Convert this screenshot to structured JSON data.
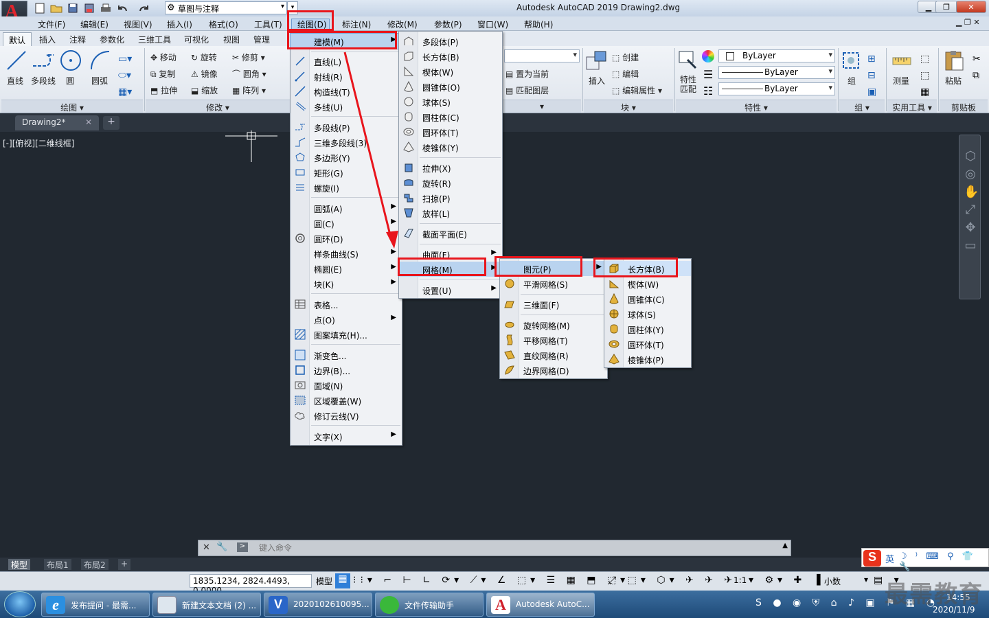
{
  "titlebar": {
    "workspace": "草图与注释",
    "window_title": "Autodesk AutoCAD 2019    Drawing2.dwg"
  },
  "menubar": {
    "items": [
      "文件(F)",
      "编辑(E)",
      "视图(V)",
      "插入(I)",
      "格式(O)",
      "工具(T)",
      "绘图(D)",
      "标注(N)",
      "修改(M)",
      "参数(P)",
      "窗口(W)",
      "帮助(H)"
    ]
  },
  "ribbon_tabs": [
    "默认",
    "插入",
    "注释",
    "参数化",
    "三维工具",
    "可视化",
    "视图",
    "管理"
  ],
  "ribbon": {
    "draw": [
      "直线",
      "多段线",
      "圆",
      "圆弧"
    ],
    "modify": [
      "移动",
      "旋转",
      "修剪",
      "复制",
      "镜像",
      "圆角",
      "拉伸",
      "缩放",
      "阵列"
    ],
    "layers": [
      "置为当前",
      "匹配图层"
    ],
    "block": [
      "插入",
      "创建",
      "编辑",
      "编辑属性"
    ],
    "properties": {
      "match": "特性匹配",
      "color": "ByLayer",
      "linetype": "ByLayer",
      "lineweight": "ByLayer"
    },
    "groups": [
      "组"
    ],
    "utilities": [
      "测量"
    ],
    "clipboard": [
      "粘贴"
    ],
    "panel_titles": [
      "绘图",
      "修改",
      "块",
      "特性",
      "组",
      "实用工具",
      "剪贴板"
    ]
  },
  "file_tab": "Drawing2*",
  "viewport_label": "[-][俯视][二维线框]",
  "draw_menu": {
    "items": [
      "建模(M)",
      "直线(L)",
      "射线(R)",
      "构造线(T)",
      "多线(U)",
      "多段线(P)",
      "三维多段线(3)",
      "多边形(Y)",
      "矩形(G)",
      "螺旋(I)",
      "圆弧(A)",
      "圆(C)",
      "圆环(D)",
      "样条曲线(S)",
      "椭圆(E)",
      "块(K)",
      "表格...",
      "点(O)",
      "图案填充(H)...",
      "渐变色...",
      "边界(B)...",
      "面域(N)",
      "区域覆盖(W)",
      "修订云线(V)",
      "文字(X)"
    ]
  },
  "modeling_menu": {
    "items": [
      "多段体(P)",
      "长方体(B)",
      "楔体(W)",
      "圆锥体(O)",
      "球体(S)",
      "圆柱体(C)",
      "圆环体(T)",
      "棱锥体(Y)",
      "拉伸(X)",
      "旋转(R)",
      "扫掠(P)",
      "放样(L)",
      "截面平面(E)",
      "曲面(F)",
      "网格(M)",
      "设置(U)"
    ]
  },
  "mesh_menu": {
    "items": [
      "图元(P)",
      "平滑网格(S)",
      "三维面(F)",
      "旋转网格(M)",
      "平移网格(T)",
      "直纹网格(R)",
      "边界网格(D)"
    ]
  },
  "primitive_menu": {
    "items": [
      "长方体(B)",
      "楔体(W)",
      "圆锥体(C)",
      "球体(S)",
      "圆柱体(Y)",
      "圆环体(T)",
      "棱锥体(P)"
    ]
  },
  "cmdline": {
    "placeholder": "键入命令"
  },
  "layout_tabs": [
    "模型",
    "布局1",
    "布局2"
  ],
  "status": {
    "coords": "1835.1234, 2824.4493, 0.0000",
    "model": "模型",
    "scale": "1:1",
    "units": "小数"
  },
  "taskbar": {
    "tasks": [
      "发布提问 - 最需...",
      "新建文本文档 (2) ...",
      "2020102610095...",
      "文件传输助手",
      "Autodesk AutoC..."
    ],
    "clock_time": "14:55",
    "clock_date": "2020/11/9"
  },
  "ime": {
    "lang": "英"
  },
  "watermark": "最需教育",
  "colors": {
    "highlight": "#e8151c",
    "canvas": "#212830"
  }
}
